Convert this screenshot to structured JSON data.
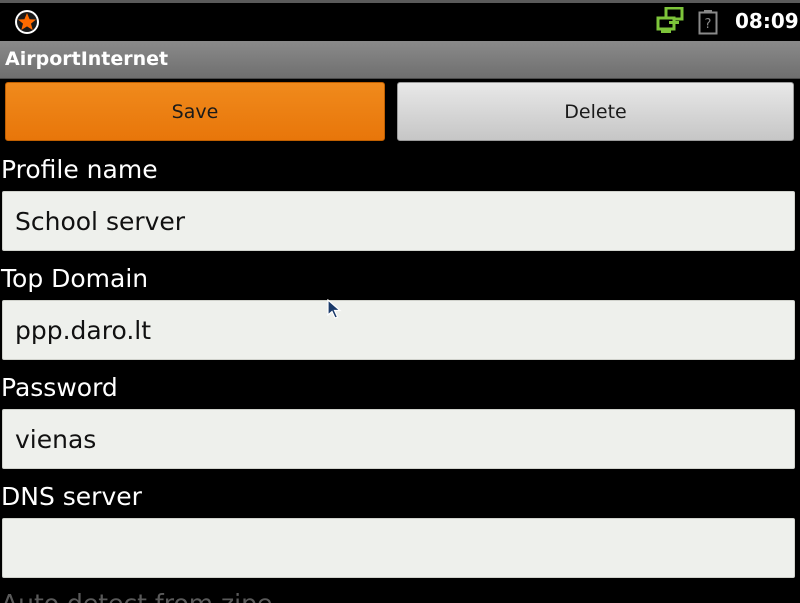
{
  "status_bar": {
    "time": "08:09",
    "icons": [
      "app-notification-star-icon",
      "network-sync-icon",
      "battery-unknown-icon"
    ],
    "network_icon_color": "#7dc43a",
    "star_color": "#ff6a00"
  },
  "title_bar": {
    "title": "AirportInternet"
  },
  "toolbar": {
    "save_label": "Save",
    "delete_label": "Delete",
    "save_color": "#e8760a",
    "delete_color": "#d6d6d6"
  },
  "form": {
    "profile_name": {
      "label": "Profile name",
      "value": "School server"
    },
    "top_domain": {
      "label": "Top Domain",
      "value": "ppp.daro.lt"
    },
    "password": {
      "label": "Password",
      "value": "vienas"
    },
    "dns_server": {
      "label": "DNS server",
      "value": ""
    },
    "auto_detect": {
      "label": "Auto detect from zipe"
    }
  }
}
